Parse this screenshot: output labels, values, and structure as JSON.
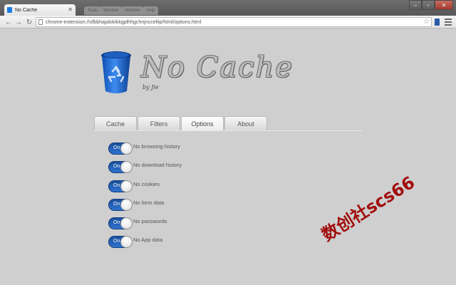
{
  "browser": {
    "active_tab_title": "No Cache",
    "background_tabs": [
      "Tools",
      "Window",
      "Window",
      "Help"
    ],
    "url": "chrome-extension://ofbbhajalokikkgplhhgchnjnccefiip/html/options.html"
  },
  "header": {
    "title": "No Cache",
    "byline": "by Jie"
  },
  "tabs": [
    {
      "label": "Cache"
    },
    {
      "label": "Filters"
    },
    {
      "label": "Options",
      "active": true
    },
    {
      "label": "About"
    }
  ],
  "options": [
    {
      "state": "On",
      "label": "No browsing history"
    },
    {
      "state": "On",
      "label": "No download history"
    },
    {
      "state": "On",
      "label": "No cookies"
    },
    {
      "state": "On",
      "label": "No form data"
    },
    {
      "state": "On",
      "label": "No passwords"
    },
    {
      "state": "On",
      "label": "No App data"
    }
  ],
  "watermark": "数创社scs66",
  "colors": {
    "toggle_on": "#2a63b8",
    "page_background": "#cfcfcf",
    "watermark": "#a10d0d"
  },
  "icons": [
    "favicon-icon",
    "close-icon",
    "back-icon",
    "forward-icon",
    "reload-icon",
    "page-icon",
    "star-icon",
    "extension-icon",
    "menu-icon",
    "recycle-bin-icon"
  ]
}
